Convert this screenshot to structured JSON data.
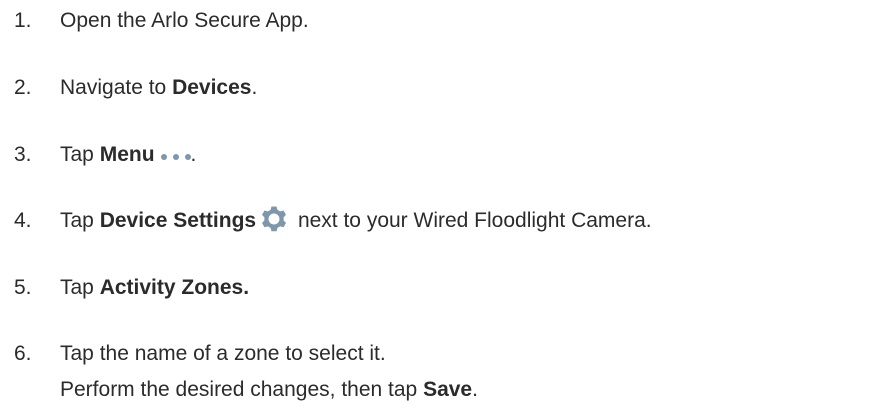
{
  "steps": [
    {
      "num": "1.",
      "pre": "Open the Arlo Secure App.",
      "bold": "",
      "post": ""
    },
    {
      "num": "2.",
      "pre": "Navigate to ",
      "bold": "Devices",
      "post": "."
    },
    {
      "num": "3.",
      "pre": "Tap ",
      "bold": "Menu",
      "post": "."
    },
    {
      "num": "4.",
      "pre": "Tap ",
      "bold": "Device Settings",
      "post": " next to your Wired Floodlight Camera."
    },
    {
      "num": "5.",
      "pre": "Tap ",
      "bold": "Activity Zones.",
      "post": ""
    },
    {
      "num": "6.",
      "pre": "Tap the name of a zone to select it.",
      "bold": "",
      "post": ""
    }
  ],
  "step6_line2": {
    "pre": "Perform the desired changes, then tap ",
    "bold": "Save",
    "post": "."
  },
  "icons": {
    "menu": "more-dots-icon",
    "settings": "gear-icon",
    "icon_color": "#7f97ab"
  }
}
